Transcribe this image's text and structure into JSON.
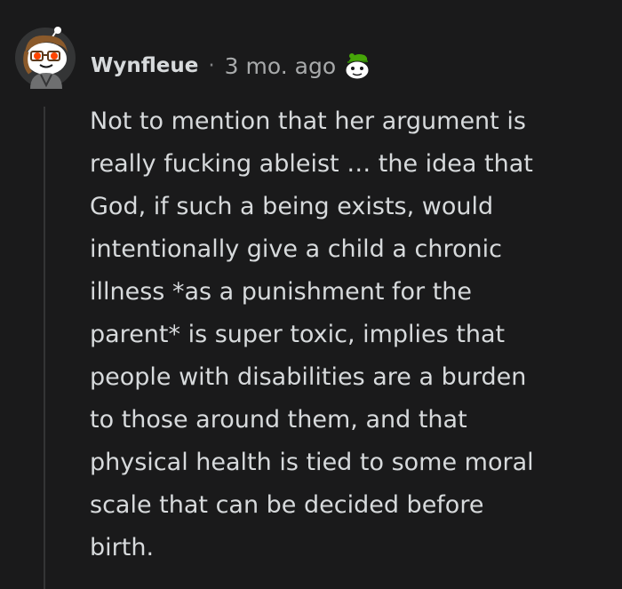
{
  "comment": {
    "username": "Wynfleue",
    "separator": "·",
    "timestamp": "3 mo. ago",
    "avatar_icon": "snoo-avatar-icon",
    "flair_icon": "snoo-flair-icon",
    "body": "Not to mention that her argument is\nreally fucking ableist … the idea that\nGod, if such a being exists, would\nintentionally give a child a chronic\nillness *as a punishment for the\nparent* is super toxic, implies that\npeople with disabilities are a burden\nto those around them, and that\nphysical health is tied to some moral\nscale that can be decided before\nbirth."
  },
  "colors": {
    "background": "#1a1a1b",
    "text": "#d7dadc",
    "meta": "#a8aaab",
    "thread_line": "#343536",
    "avatar_bg": "#343536",
    "avatar_eyes": "#ff4500",
    "flair_hat": "#46a508"
  }
}
